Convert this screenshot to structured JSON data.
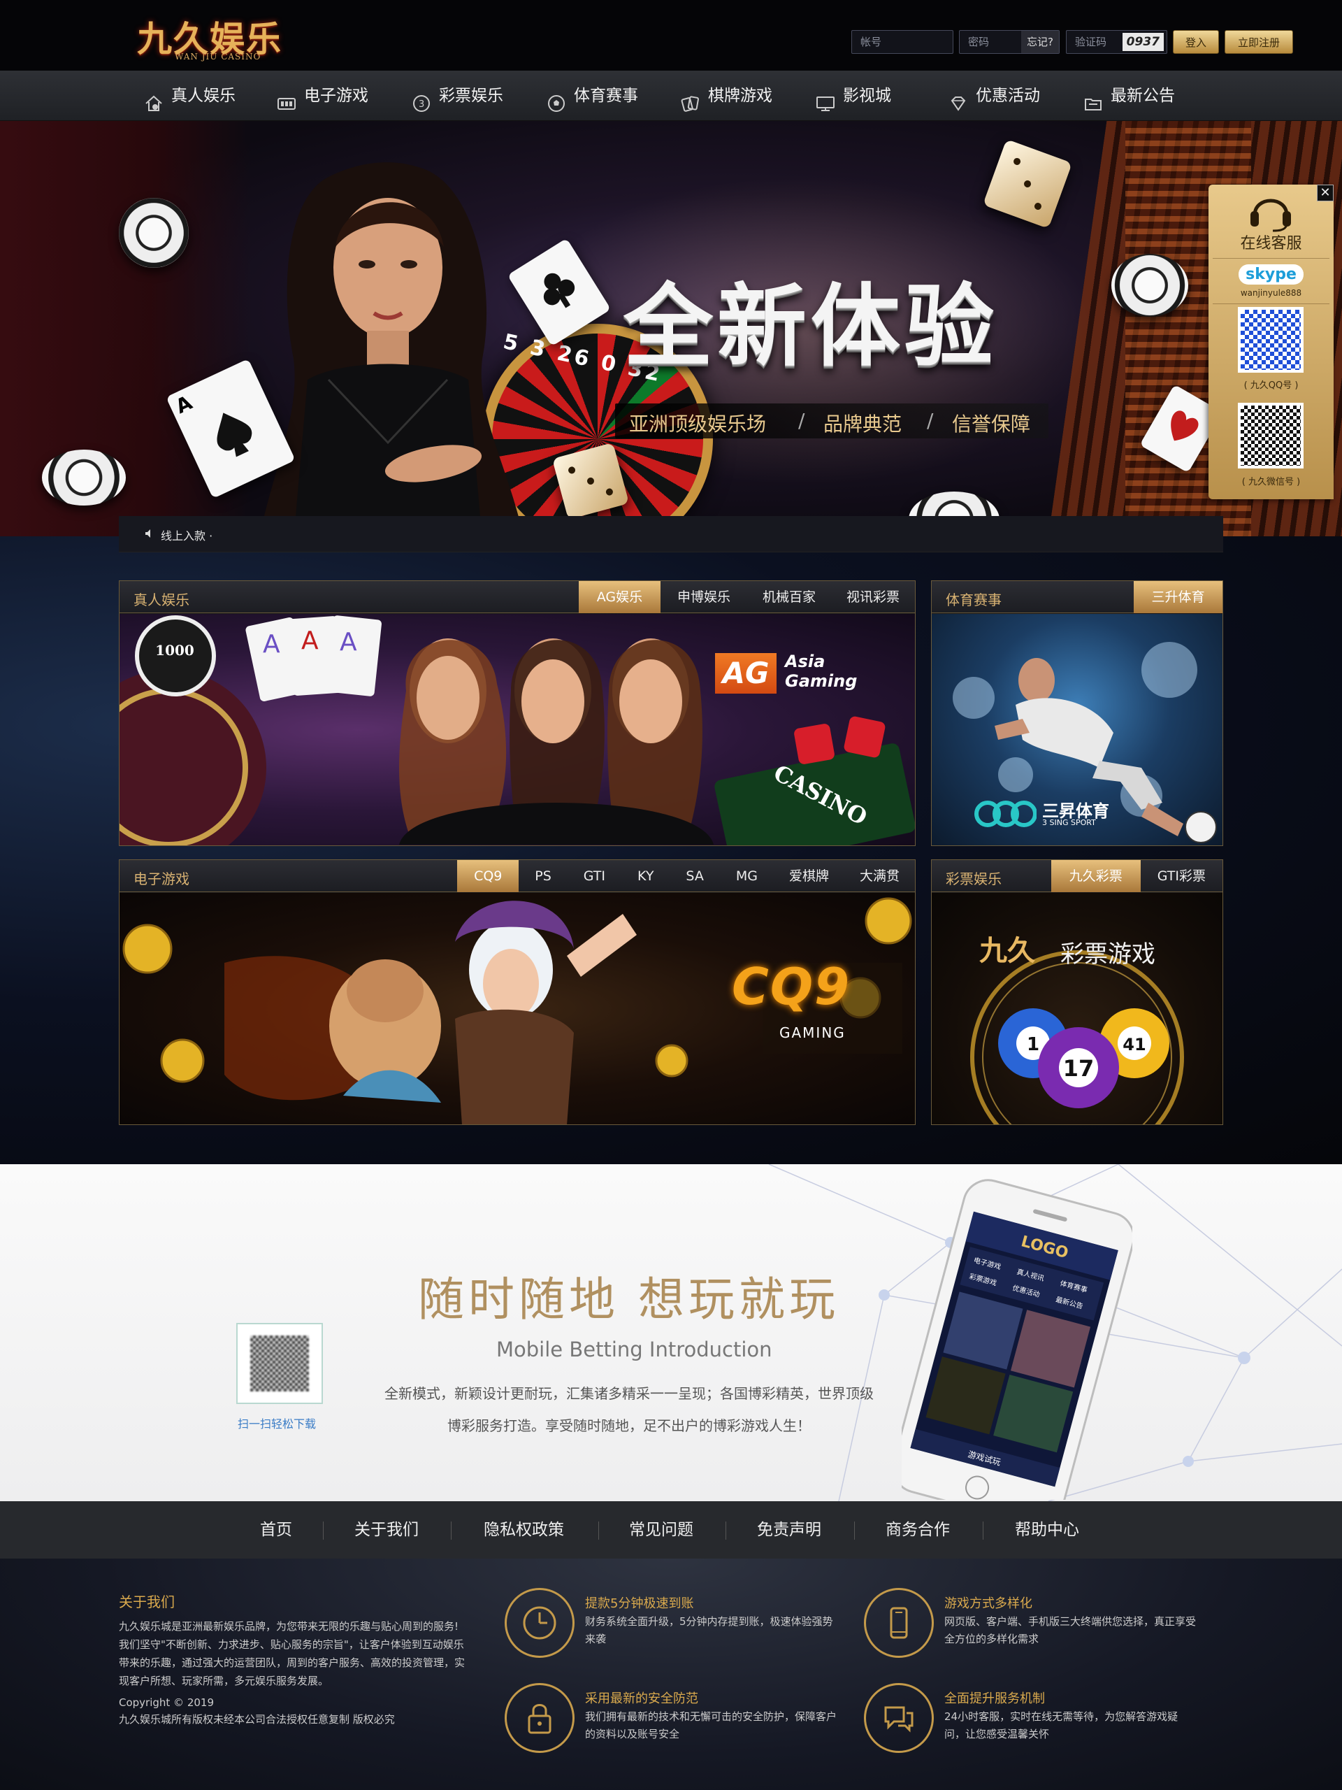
{
  "header": {
    "logo_main": "九久娱乐",
    "logo_sub": "WAN JIU CASINO",
    "account_placeholder": "帐号",
    "password_placeholder": "密码",
    "forgot_label": "忘记?",
    "captcha_placeholder": "验证码",
    "captcha_code": "0937",
    "login_button": "登入",
    "register_button": "立即注册"
  },
  "nav": {
    "items": [
      {
        "label": "真人娱乐",
        "icon": "house-icon"
      },
      {
        "label": "电子游戏",
        "icon": "slot-machine-icon"
      },
      {
        "label": "彩票娱乐",
        "icon": "lottery-ball-icon"
      },
      {
        "label": "体育赛事",
        "icon": "soccer-ball-icon"
      },
      {
        "label": "棋牌游戏",
        "icon": "cards-icon"
      },
      {
        "label": "影视城",
        "icon": "monitor-icon"
      },
      {
        "label": "优惠活动",
        "icon": "diamond-icon"
      },
      {
        "label": "最新公告",
        "icon": "folder-icon"
      }
    ]
  },
  "banner": {
    "headline": "全新体验",
    "tagline": [
      "亚洲顶级娱乐场",
      "品牌典范",
      "信誉保障"
    ],
    "separator": "/",
    "roulette_numbers": "5 3 26 0 32"
  },
  "service": {
    "close": "✕",
    "online_label": "在线客服",
    "skype_label": "skype",
    "skype_id": "wanjinyule888",
    "qq_label": "( 九久QQ号 )",
    "wechat_label": "( 九久微信号 )"
  },
  "notice": {
    "text": "线上入款 ·"
  },
  "panels": {
    "live": {
      "title": "真人娱乐",
      "tabs": [
        "AG娱乐",
        "申博娱乐",
        "机械百家",
        "视讯彩票"
      ],
      "brand_logo": "AG",
      "brand_line1": "Asia",
      "brand_line2": "Gaming",
      "chip_value": "1000",
      "casino_text": "CASINO"
    },
    "sports": {
      "title": "体育赛事",
      "tabs": [
        "三升体育"
      ],
      "brand_cn": "三昇体育",
      "brand_en": "3 SING SPORT"
    },
    "slots": {
      "title": "电子游戏",
      "tabs": [
        "CQ9",
        "PS",
        "GTI",
        "KY",
        "SA",
        "MG",
        "爱棋牌",
        "大满贯"
      ],
      "brand": "CQ9",
      "brand_sub": "GAMING"
    },
    "lottery": {
      "title": "彩票娱乐",
      "tabs": [
        "九久彩票",
        "GTI彩票"
      ],
      "game_logo": "九久",
      "game_title": "彩票游戏",
      "balls": [
        "1",
        "17",
        "41"
      ]
    }
  },
  "mobile": {
    "title": "随时随地 想玩就玩",
    "subtitle": "Mobile Betting Introduction",
    "desc_line1": "全新模式，新颖设计更耐玩，汇集诸多精采一一呈现；各国博彩精英，世界顶级",
    "desc_line2": "博彩服务打造。享受随时随地，足不出户的博彩游戏人生！",
    "qr_caption": "扫一扫轻松下载",
    "phone_logo": "LOGO",
    "phone_menu": [
      "电子游戏",
      "真人视讯",
      "体育赛事",
      "彩票游戏",
      "优惠活动",
      "最新公告"
    ],
    "phone_bottom": "游戏试玩"
  },
  "footer_nav": [
    "首页",
    "关于我们",
    "隐私权政策",
    "常见问题",
    "免责声明",
    "商务合作",
    "帮助中心"
  ],
  "footer": {
    "about_title": "关于我们",
    "about_text": "九久娱乐城是亚洲最新娱乐品牌，为您带来无限的乐趣与贴心周到的服务!我们坚守\"不断创新、力求进步、贴心服务的宗旨\"，让客户体验到互动娱乐带来的乐趣，通过强大的运营团队，周到的客户服务、高效的投资管理，实现客户所想、玩家所需，多元娱乐服务发展。",
    "copyright": "Copyright © 2019",
    "rights": "九久娱乐城所有版权未经本公司合法授权任意复制 版权必究",
    "features": [
      {
        "title": "提款5分钟极速到账",
        "desc": "财务系统全面升级，5分钟内存提到账，极速体验强势来袭",
        "icon": "clock-icon"
      },
      {
        "title": "游戏方式多样化",
        "desc": "网页版、客户端、手机版三大终端供您选择，真正享受全方位的多样化需求",
        "icon": "mobile-phone-icon"
      },
      {
        "title": "采用最新的安全防范",
        "desc": "我们拥有最新的技术和无懈可击的安全防护，保障客户的资料以及账号安全",
        "icon": "padlock-icon"
      },
      {
        "title": "全面提升服务机制",
        "desc": "24小时客服，实时在线无需等待，为您解答游戏疑问，让您感受温馨关怀",
        "icon": "chat-bubbles-icon"
      }
    ]
  },
  "colors": {
    "gold": "#d8b272",
    "accent_tab": "#c99a55",
    "nav_bg": "#27292d",
    "mobile_title": "#b09060"
  }
}
